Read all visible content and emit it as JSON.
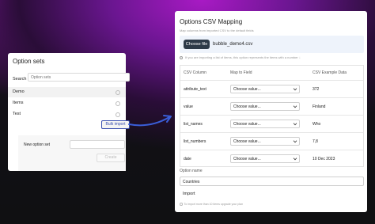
{
  "option_sets": {
    "title": "Option sets",
    "search_label": "Search",
    "search_placeholder": "Option sets",
    "items": [
      {
        "label": "Demo"
      },
      {
        "label": "Items"
      },
      {
        "label": "Test"
      }
    ],
    "bulk_import_label": "Bulk import",
    "new_option_set_label": "New option set",
    "create_label": "Create"
  },
  "mapping": {
    "title": "Options CSV Mapping",
    "subtitle": "Map columns from imported CSV to the default fields",
    "choose_file_label": "Choose file",
    "file_name": "bubble_demo4.csv",
    "info_text": "If you are importing a list of items, this option represents the items with a number ↓",
    "columns": [
      "CSV Column",
      "Map to Field",
      "CSV Example Data"
    ],
    "rows": [
      {
        "csv_column": "attribute_text",
        "map_to": "Choose value...",
        "example": "372"
      },
      {
        "csv_column": "value",
        "map_to": "Choose value...",
        "example": "Finland"
      },
      {
        "csv_column": "list_names",
        "map_to": "Choose value...",
        "example": "Who"
      },
      {
        "csv_column": "list_numbers",
        "map_to": "Choose value...",
        "example": "7,8"
      },
      {
        "csv_column": "date",
        "map_to": "Choose value...",
        "example": "10 Dec 2023"
      }
    ],
    "option_name_label": "Option name",
    "option_name_value": "Countries",
    "import_label": "Import",
    "import_note": "To import more than 10 items upgrade your plan"
  },
  "colors": {
    "accent_blue": "#3a4fb0",
    "choose_button_bg": "#2e3a48",
    "file_bar_bg": "#eef3fb",
    "arrow": "#3a5ed8"
  }
}
